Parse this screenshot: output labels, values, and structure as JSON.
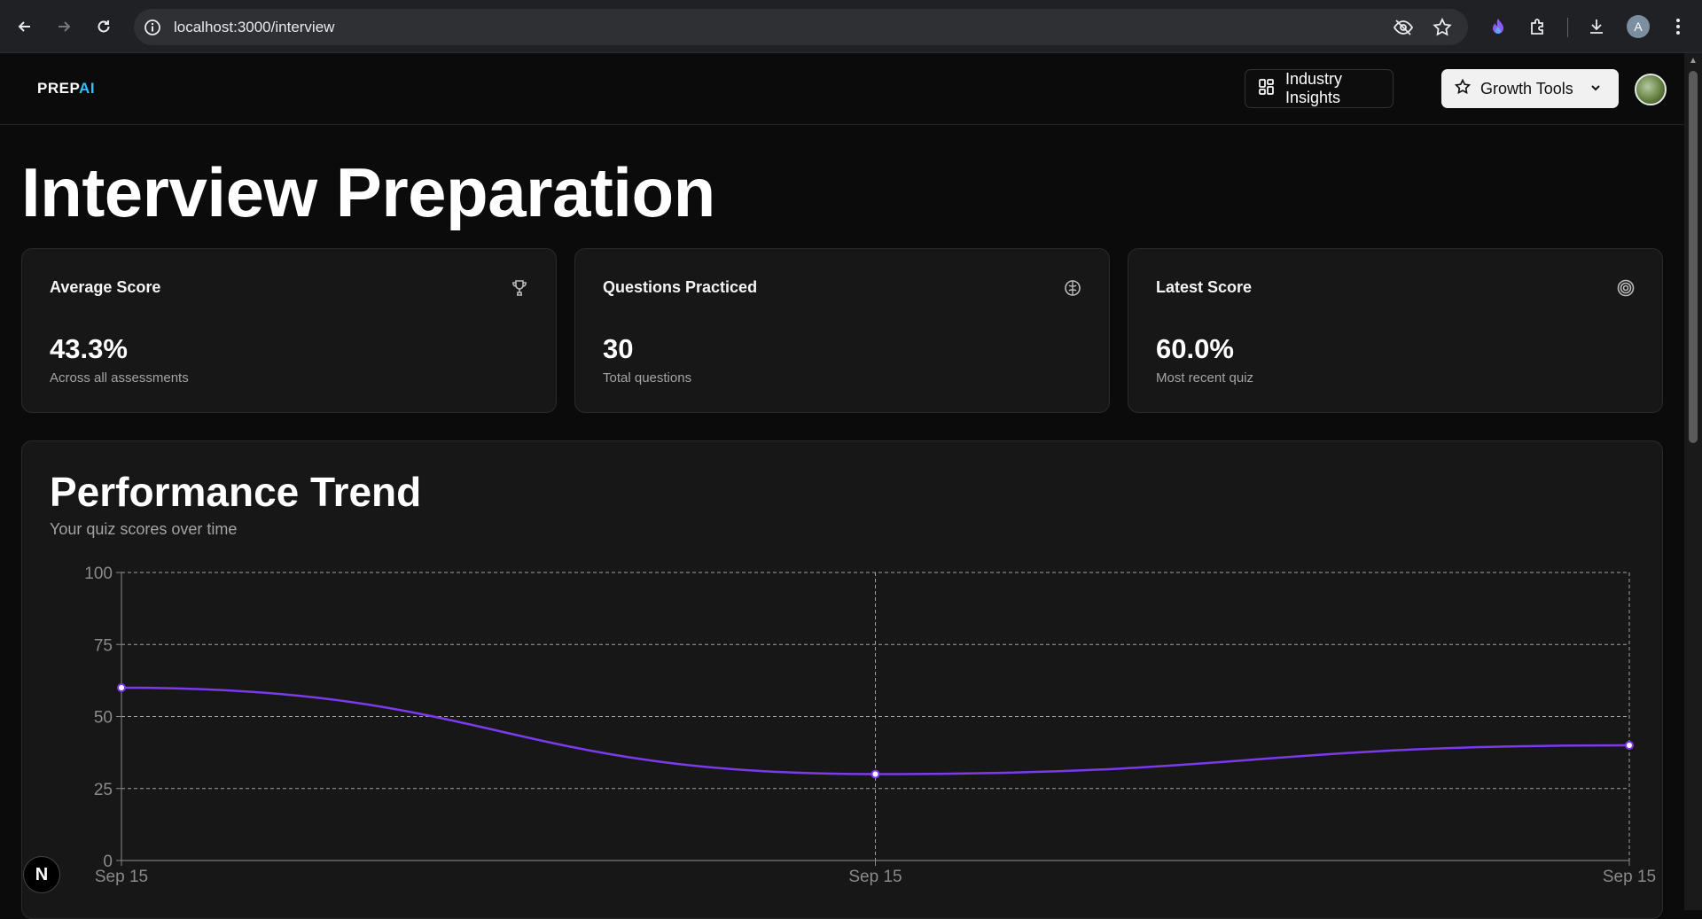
{
  "browser": {
    "url": "localhost:3000/interview",
    "profile_initial": "A",
    "icons": [
      "back-arrow-icon",
      "forward-arrow-icon",
      "reload-icon",
      "site-info-icon",
      "eye-off-icon",
      "star-icon",
      "extension-flame-icon",
      "puzzle-icon",
      "download-icon",
      "kebab-menu-icon"
    ]
  },
  "header": {
    "logo_prefix": "PREP",
    "logo_suffix": "AI",
    "insights_label": "Industry Insights",
    "growth_label": "Growth Tools"
  },
  "page": {
    "title": "Interview Preparation"
  },
  "stats": [
    {
      "title": "Average Score",
      "value": "43.3%",
      "sub": "Across all assessments",
      "icon": "trophy-icon"
    },
    {
      "title": "Questions Practiced",
      "value": "30",
      "sub": "Total questions",
      "icon": "brain-icon"
    },
    {
      "title": "Latest Score",
      "value": "60.0%",
      "sub": "Most recent quiz",
      "icon": "target-icon"
    }
  ],
  "trend": {
    "title": "Performance Trend",
    "subtitle": "Your quiz scores over time"
  },
  "colors": {
    "line": "#7c3aed",
    "background": "#0b0b0b",
    "card": "#171717"
  },
  "chart_data": {
    "type": "line",
    "x": [
      "Sep 15",
      "Sep 15",
      "Sep 15"
    ],
    "series": [
      {
        "values": [
          60,
          30,
          40
        ]
      }
    ],
    "yticks": [
      0,
      25,
      50,
      75,
      100
    ],
    "ylim": [
      0,
      100
    ],
    "grid": true,
    "title": "",
    "xlabel": "",
    "ylabel": ""
  },
  "next_badge": "N"
}
